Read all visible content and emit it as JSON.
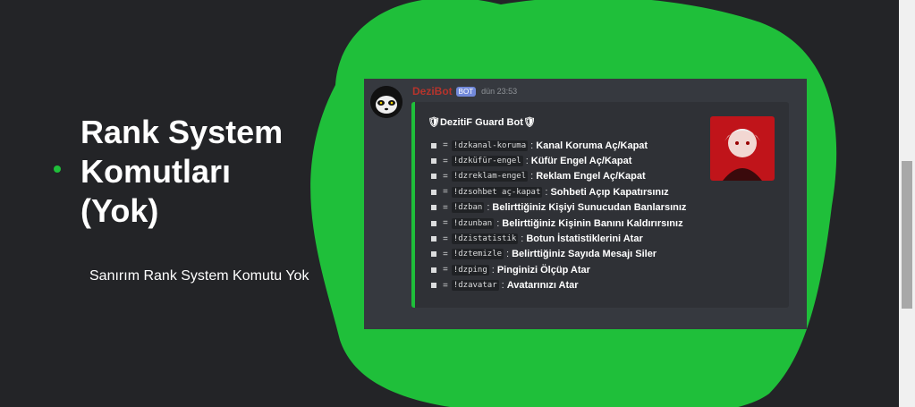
{
  "colors": {
    "background": "#232427",
    "accent_green": "#1fbf3a",
    "embed_bg": "#2f3136",
    "panel_bg": "#36393f",
    "bot_name": "#b5342c"
  },
  "slide": {
    "heading": "Rank System\nKomutları\n(Yok)",
    "subtext": "Sanırım Rank System Komutu Yok"
  },
  "message": {
    "bot_name": "DeziBot",
    "badge": "BOT",
    "timestamp": "dün 23:53",
    "embed_title": "🛡DezitiF Guard Bot🛡",
    "separator": ":",
    "eq": "=",
    "commands": [
      {
        "cmd": "!dzkanal-koruma",
        "desc": "Kanal Koruma Aç/Kapat"
      },
      {
        "cmd": "!dzküfür-engel",
        "desc": "Küfür Engel Aç/Kapat"
      },
      {
        "cmd": "!dzreklam-engel",
        "desc": "Reklam Engel Aç/Kapat"
      },
      {
        "cmd": "!dzsohbet aç-kapat",
        "desc": "Sohbeti Açıp Kapatırsınız"
      },
      {
        "cmd": "!dzban",
        "desc": "Belirttiğiniz Kişiyi Sunucudan Banlarsınız"
      },
      {
        "cmd": "!dzunban",
        "desc": "Belirttiğiniz Kişinin Banını Kaldırırsınız"
      },
      {
        "cmd": "!dzistatistik",
        "desc": "Botun İstatistiklerini Atar"
      },
      {
        "cmd": "!dztemizle",
        "desc": "Belirttiğiniz Sayıda Mesajı Siler"
      },
      {
        "cmd": "!dzping",
        "desc": "Pinginizi Ölçüp Atar"
      },
      {
        "cmd": "!dzavatar",
        "desc": "Avatarınızı Atar"
      }
    ]
  },
  "scrollbar": {
    "position_fraction": 0.4
  }
}
